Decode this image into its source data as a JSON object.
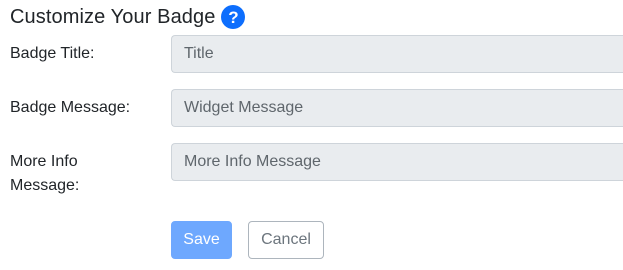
{
  "header": {
    "title": "Customize Your Badge",
    "help_icon": "question-circle-icon",
    "help_glyph": "?"
  },
  "form": {
    "fields": [
      {
        "label": "Badge Title:",
        "placeholder": "Title",
        "value": ""
      },
      {
        "label": "Badge Message:",
        "placeholder": "Widget Message",
        "value": ""
      },
      {
        "label_line1": "More Info",
        "label_line2": "Message:",
        "placeholder": "More Info Message",
        "value": ""
      }
    ],
    "save_label": "Save",
    "cancel_label": "Cancel"
  },
  "colors": {
    "accent": "#0d6efd",
    "save_button": "#6ea8fe",
    "input_background": "#e9ecef"
  }
}
